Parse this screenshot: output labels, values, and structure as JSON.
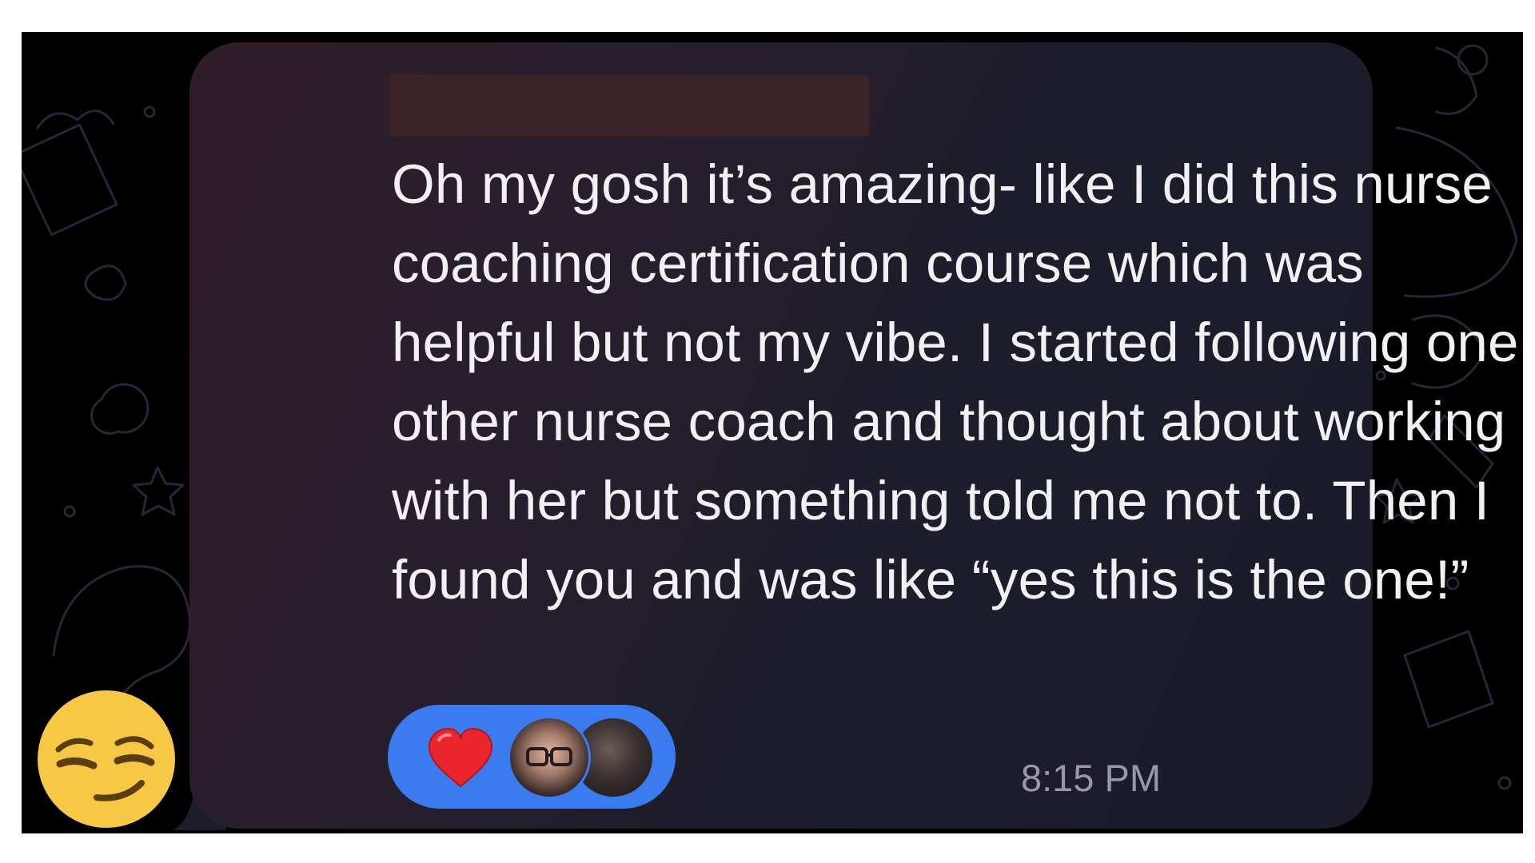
{
  "message": {
    "text": "Oh my gosh it’s amazing- like I did this nurse coaching certification course which was helpful but not my vibe. I started following one other nurse coach and thought about working with her but something told me not to. Then I found you and was like “yes this is the one!”",
    "timestamp": "8:15 PM"
  },
  "reactions": {
    "icon": "heart-icon",
    "color": "#3a7cf0",
    "heart_color": "#e8262b"
  },
  "sticker": {
    "icon": "smirking-face-emoji"
  },
  "colors": {
    "background": "#000000",
    "bubble": "#241d2b",
    "text": "#f2f0f3",
    "timestamp": "#9a98a6"
  }
}
